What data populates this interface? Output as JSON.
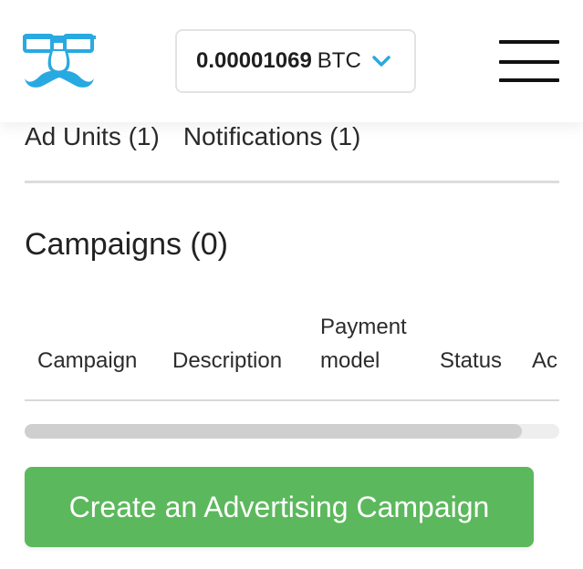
{
  "header": {
    "logo_icon": "glasses-mustache-logo-icon",
    "balance": {
      "amount": "0.00001069",
      "currency": "BTC",
      "dropdown_icon": "chevron-down-icon"
    },
    "menu_icon": "hamburger-menu-icon"
  },
  "tabs": [
    {
      "label": "Ad Units (1)"
    },
    {
      "label": "Notifications (1)"
    }
  ],
  "campaigns": {
    "title": "Campaigns (0)",
    "columns": [
      "Campaign",
      "Description",
      "Payment model",
      "Status",
      "Ac"
    ],
    "scroll_position": 0.93
  },
  "cta": {
    "label": "Create an Advertising Campaign"
  },
  "colors": {
    "accent_blue": "#29a9e1",
    "cta_green": "#5cb85c"
  }
}
